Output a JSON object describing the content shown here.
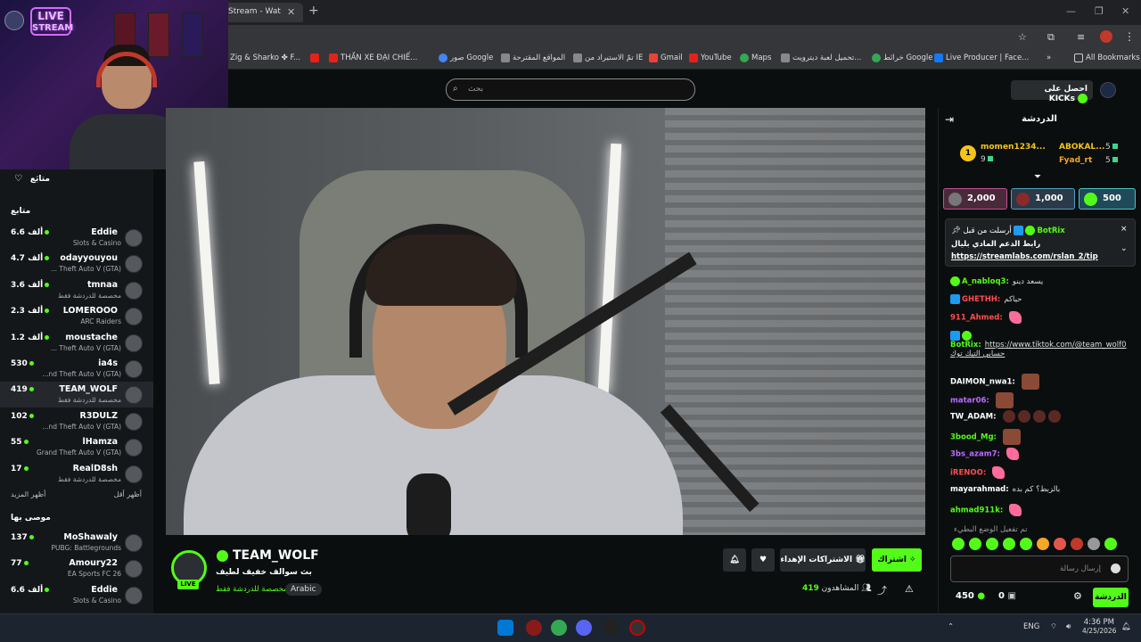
{
  "browser": {
    "tab_title": "Stream - Wat",
    "new_tab": "+",
    "bookmarks": [
      "Zig & Sharko ✤ F...",
      "THẦN XE ĐẠI CHIẾ...",
      "صور Google",
      "المواقع المقترحة",
      "تمّ الاستيراد من IE",
      "Gmail",
      "YouTube",
      "Maps",
      "تحميل لعبة ديترويت...",
      "خرائط Google",
      "Live Producer | Face..."
    ],
    "all_bookmarks": "All Bookmarks"
  },
  "header": {
    "search_placeholder": "بحث",
    "get_kicks": "احصل على KICKs"
  },
  "overlay": {
    "live_badge_line1": "LIVE",
    "live_badge_line2": "STREAM"
  },
  "sidebar": {
    "following_title": "متابَع",
    "following_label": "متابع",
    "channels": [
      {
        "name": "Eddie",
        "category": "Slots & Casino",
        "viewers": "6.6 ألف"
      },
      {
        "name": "odayyouyou",
        "category": "... Theft Auto V (GTA)",
        "viewers": "4.7 ألف"
      },
      {
        "name": "tmnaa",
        "category": "مخصصة للدردشة فقط",
        "viewers": "3.6 ألف"
      },
      {
        "name": "LOMEROOO",
        "category": "ARC Raiders",
        "viewers": "2.3 ألف"
      },
      {
        "name": "moustache",
        "category": "... Theft Auto V (GTA)",
        "viewers": "1.2 ألف"
      },
      {
        "name": "ia4s",
        "category": "...nd Theft Auto V (GTA)",
        "viewers": "530"
      },
      {
        "name": "TEAM_WOLF",
        "category": "مخصصة للدردشة فقط",
        "viewers": "419"
      },
      {
        "name": "R3DULZ",
        "category": "...nd Theft Auto V (GTA)",
        "viewers": "102"
      },
      {
        "name": "lHamza",
        "category": "Grand Theft Auto V (GTA)",
        "viewers": "55"
      },
      {
        "name": "RealD8sh",
        "category": "مخصصة للدردشة فقط",
        "viewers": "17"
      }
    ],
    "show_more": "أظهر المزيد",
    "show_less": "أظهر أقل",
    "recommended_title": "موصى بها",
    "recommended": [
      {
        "name": "MoShawaly",
        "category": "PUBG: Battlegrounds",
        "viewers": "137"
      },
      {
        "name": "Amoury22",
        "category": "EA Sports FC 26",
        "viewers": "77"
      },
      {
        "name": "Eddie",
        "category": "Slots & Casino",
        "viewers": "6.6 ألف"
      }
    ]
  },
  "stream": {
    "channel_name": "TEAM_WOLF",
    "live": "LIVE",
    "title": "بث سوالف خفيف لطيف",
    "category": "مخصصة للدردشة فقط",
    "tag": "Arabic",
    "subscribe": "اشتراك",
    "gift_subs": "الاشتراكات الإهداء",
    "viewers_label": "المشاهدون",
    "viewers_count": "419"
  },
  "chat": {
    "title": "الدردشة",
    "leaderboard": [
      {
        "rank": "1",
        "name": "momen1234...",
        "count": "9"
      },
      {
        "name": "ABOKAL...",
        "count": "5"
      },
      {
        "name": "Fyad_rt",
        "count": "5"
      }
    ],
    "gifts": [
      "2,000",
      "1,000",
      "500"
    ],
    "pinned": {
      "label": "أرسلت من قبل",
      "user": "BotRix",
      "text": "رابط الدعم المادي بليال",
      "link": "https://streamlabs.com/rslan_2/tip"
    },
    "messages": [
      {
        "user": "A_nabloq3:",
        "text": "يسعد دينو",
        "color": "#53fc18"
      },
      {
        "user": "GHETHH:",
        "text": "حياكم",
        "color": "#ff4d4d"
      },
      {
        "user": "911_Ahmed:",
        "text": "",
        "color": "#ff4d4d"
      },
      {
        "user": "BotRix:",
        "text": "https://www.tiktok.com/@team_wolf0 حسابي التيك توك",
        "color": "#53fc18"
      },
      {
        "user": "DAIMON_nwa1:",
        "text": "",
        "color": "#ffffff"
      },
      {
        "user": "matar06:",
        "text": "",
        "color": "#b96bff"
      },
      {
        "user": "TW_ADAM:",
        "text": "",
        "color": "#ffffff"
      },
      {
        "user": "3bood_Mg:",
        "text": "",
        "color": "#53fc18"
      },
      {
        "user": "3bs_azam7:",
        "text": "",
        "color": "#b96bff"
      },
      {
        "user": "iRENOO:",
        "text": "",
        "color": "#ff4d4d"
      },
      {
        "user": "mayarahmad:",
        "text": "كم بده ‎بالزبط؟",
        "color": "#ffffff"
      },
      {
        "user": "ahmad911k:",
        "text": "",
        "color": "#53fc18"
      },
      {
        "user": "",
        "text": "تم تفعيل الوضع البطيء",
        "color": "#999999"
      }
    ],
    "input_placeholder": "إرسال رسالة",
    "send": "الدردشة",
    "points": "450",
    "kicks": "0"
  },
  "taskbar": {
    "lang": "ENG",
    "time": "4:36 PM",
    "date": "4/25/2026"
  },
  "colors": {
    "accent": "#53fc18",
    "bg": "#0b0e0f",
    "sidebar": "#14171a"
  }
}
